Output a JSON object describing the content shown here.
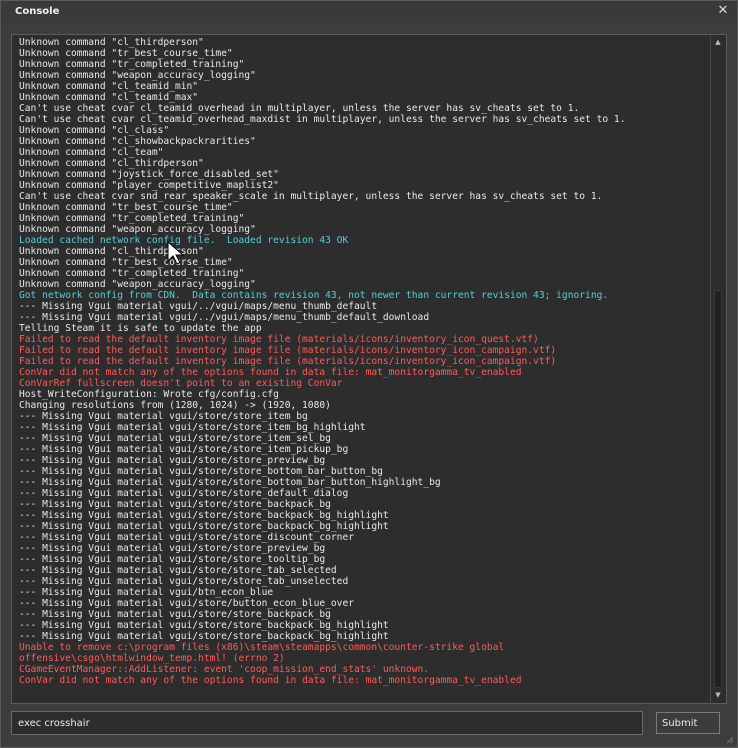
{
  "window": {
    "title": "Console",
    "close_glyph": "✕"
  },
  "log": {
    "lines": [
      {
        "text": "Unknown command \"cl_thirdperson\"",
        "color": "#e8e8e8"
      },
      {
        "text": "Unknown command \"tr_best_course_time\"",
        "color": "#e8e8e8"
      },
      {
        "text": "Unknown command \"tr_completed_training\"",
        "color": "#e8e8e8"
      },
      {
        "text": "Unknown command \"weapon_accuracy_logging\"",
        "color": "#e8e8e8"
      },
      {
        "text": "Unknown command \"cl_teamid_min\"",
        "color": "#e8e8e8"
      },
      {
        "text": "Unknown command \"cl_teamid_max\"",
        "color": "#e8e8e8"
      },
      {
        "text": "Can't use cheat cvar cl_teamid_overhead in multiplayer, unless the server has sv_cheats set to 1.",
        "color": "#e8e8e8"
      },
      {
        "text": "Can't use cheat cvar cl_teamid_overhead_maxdist in multiplayer, unless the server has sv_cheats set to 1.",
        "color": "#e8e8e8"
      },
      {
        "text": "Unknown command \"cl_class\"",
        "color": "#e8e8e8"
      },
      {
        "text": "Unknown command \"cl_showbackpackrarities\"",
        "color": "#e8e8e8"
      },
      {
        "text": "Unknown command \"cl_team\"",
        "color": "#e8e8e8"
      },
      {
        "text": "Unknown command \"cl_thirdperson\"",
        "color": "#e8e8e8"
      },
      {
        "text": "Unknown command \"joystick_force_disabled_set\"",
        "color": "#e8e8e8"
      },
      {
        "text": "Unknown command \"player_competitive_maplist2\"",
        "color": "#e8e8e8"
      },
      {
        "text": "Can't use cheat cvar snd_rear_speaker_scale in multiplayer, unless the server has sv_cheats set to 1.",
        "color": "#e8e8e8"
      },
      {
        "text": "Unknown command \"tr_best_course_time\"",
        "color": "#e8e8e8"
      },
      {
        "text": "Unknown command \"tr_completed_training\"",
        "color": "#e8e8e8"
      },
      {
        "text": "Unknown command \"weapon_accuracy_logging\"",
        "color": "#e8e8e8"
      },
      {
        "text": "Loaded cached network config file.  Loaded revision 43 OK",
        "color": "#4fd0d8"
      },
      {
        "text": "Unknown command \"cl_thirdperson\"",
        "color": "#e8e8e8"
      },
      {
        "text": "Unknown command \"tr_best_course_time\"",
        "color": "#e8e8e8"
      },
      {
        "text": "Unknown command \"tr_completed_training\"",
        "color": "#e8e8e8"
      },
      {
        "text": "Unknown command \"weapon_accuracy_logging\"",
        "color": "#e8e8e8"
      },
      {
        "text": "Got network config from CDN.  Data contains revision 43, not newer than current revision 43; ignoring.",
        "color": "#4fd0d8"
      },
      {
        "text": "--- Missing Vgui material vgui/../vgui/maps/menu_thumb_default",
        "color": "#e8e8e8"
      },
      {
        "text": "--- Missing Vgui material vgui/../vgui/maps/menu_thumb_default_download",
        "color": "#e8e8e8"
      },
      {
        "text": "Telling Steam it is safe to update the app",
        "color": "#e8e8e8"
      },
      {
        "text": "Failed to read the default inventory image file (materials/icons/inventory_icon_quest.vtf)",
        "color": "#ff5a5a"
      },
      {
        "text": "Failed to read the default inventory image file (materials/icons/inventory_icon_campaign.vtf)",
        "color": "#ff5a5a"
      },
      {
        "text": "Failed to read the default inventory image file (materials/icons/inventory_icon_campaign.vtf)",
        "color": "#ff5a5a"
      },
      {
        "text": "ConVar did not match any of the options found in data file: mat_monitorgamma_tv_enabled",
        "color": "#ff5a5a"
      },
      {
        "text": "ConVarRef fullscreen doesn't point to an existing ConVar",
        "color": "#ff5a5a"
      },
      {
        "text": "Host_WriteConfiguration: Wrote cfg/config.cfg",
        "color": "#e8e8e8"
      },
      {
        "text": "Changing resolutions from (1280, 1024) -> (1920, 1080)",
        "color": "#e8e8e8"
      },
      {
        "text": "--- Missing Vgui material vgui/store/store_item_bg",
        "color": "#e8e8e8"
      },
      {
        "text": "--- Missing Vgui material vgui/store/store_item_bg_highlight",
        "color": "#e8e8e8"
      },
      {
        "text": "--- Missing Vgui material vgui/store/store_item_sel_bg",
        "color": "#e8e8e8"
      },
      {
        "text": "--- Missing Vgui material vgui/store/store_item_pickup_bg",
        "color": "#e8e8e8"
      },
      {
        "text": "--- Missing Vgui material vgui/store/store_preview_bg",
        "color": "#e8e8e8"
      },
      {
        "text": "--- Missing Vgui material vgui/store/store_bottom_bar_button_bg",
        "color": "#e8e8e8"
      },
      {
        "text": "--- Missing Vgui material vgui/store/store_bottom_bar_button_highlight_bg",
        "color": "#e8e8e8"
      },
      {
        "text": "--- Missing Vgui material vgui/store/store_default_dialog",
        "color": "#e8e8e8"
      },
      {
        "text": "--- Missing Vgui material vgui/store/store_backpack_bg",
        "color": "#e8e8e8"
      },
      {
        "text": "--- Missing Vgui material vgui/store/store_backpack_bg_highlight",
        "color": "#e8e8e8"
      },
      {
        "text": "--- Missing Vgui material vgui/store/store_backpack_bg_highlight",
        "color": "#e8e8e8"
      },
      {
        "text": "--- Missing Vgui material vgui/store/store_discount_corner",
        "color": "#e8e8e8"
      },
      {
        "text": "--- Missing Vgui material vgui/store/store_preview_bg",
        "color": "#e8e8e8"
      },
      {
        "text": "--- Missing Vgui material vgui/store/store_tooltip_bg",
        "color": "#e8e8e8"
      },
      {
        "text": "--- Missing Vgui material vgui/store/store_tab_selected",
        "color": "#e8e8e8"
      },
      {
        "text": "--- Missing Vgui material vgui/store/store_tab_unselected",
        "color": "#e8e8e8"
      },
      {
        "text": "--- Missing Vgui material vgui/btn_econ_blue",
        "color": "#e8e8e8"
      },
      {
        "text": "--- Missing Vgui material vgui/store/button_econ_blue_over",
        "color": "#e8e8e8"
      },
      {
        "text": "--- Missing Vgui material vgui/store/store_backpack_bg",
        "color": "#e8e8e8"
      },
      {
        "text": "--- Missing Vgui material vgui/store/store_backpack_bg_highlight",
        "color": "#e8e8e8"
      },
      {
        "text": "--- Missing Vgui material vgui/store/store_backpack_bg_highlight",
        "color": "#e8e8e8"
      },
      {
        "text": "Unable to remove c:\\program files (x86)\\steam\\steamapps\\common\\counter-strike global",
        "color": "#ff5a5a"
      },
      {
        "text": "offensive\\csgo\\htmlwindow_temp.html! (errno 2)",
        "color": "#ff5a5a"
      },
      {
        "text": "CGameEventManager::AddListener: event 'coop_mission_end_stats' unknown.",
        "color": "#ff5a5a"
      },
      {
        "text": "ConVar did not match any of the options found in data file: mat_monitorgamma_tv_enabled",
        "color": "#ff5a5a"
      }
    ]
  },
  "scrollbar": {
    "up_glyph": "▲",
    "down_glyph": "▼",
    "position_fraction": 1.0
  },
  "command": {
    "value": "exec crosshair",
    "submit_label": "Submit"
  }
}
